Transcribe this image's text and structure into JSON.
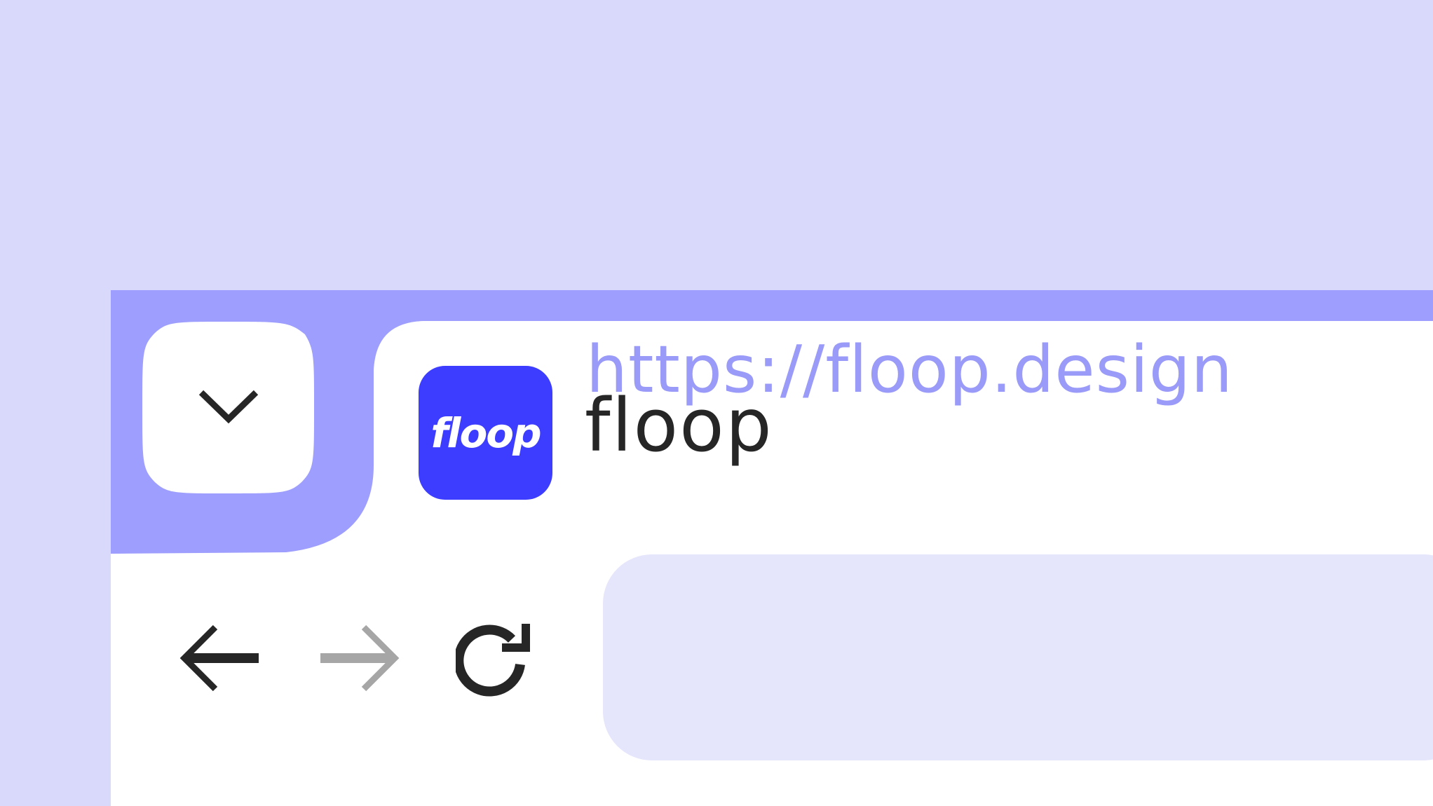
{
  "tab": {
    "title": "floop",
    "favicon_text": "floop",
    "favicon_color": "#3d3dff"
  },
  "navigation": {
    "tabs_menu_icon": "chevron-down-icon",
    "back_icon": "arrow-left-icon",
    "forward_icon": "arrow-right-icon",
    "reload_icon": "reload-icon"
  },
  "address_bar": {
    "url": "https://floop.design"
  },
  "colors": {
    "background": "#d9d9fc",
    "tab_strip": "#9e9efe",
    "address_bar": "#e5e5fc",
    "url_text": "#9a9af8",
    "forward_disabled": "#a6a6a6"
  }
}
